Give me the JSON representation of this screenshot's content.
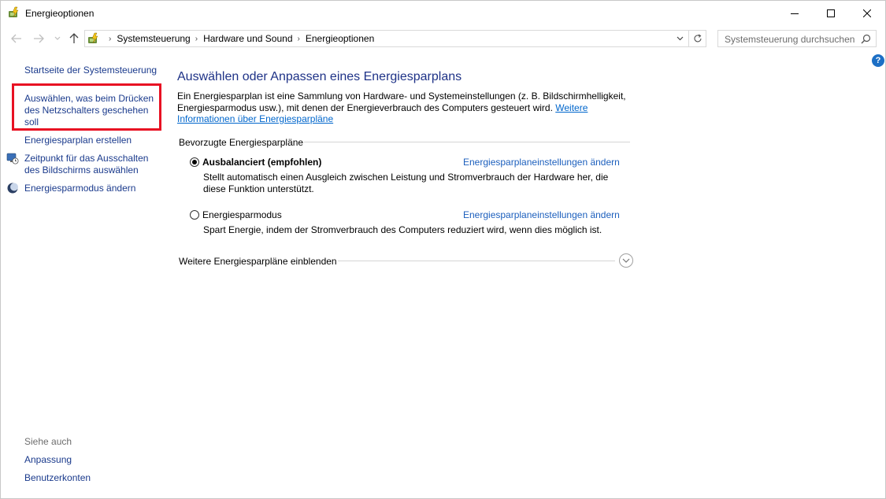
{
  "window": {
    "title": "Energieoptionen",
    "icon": "power-options-icon",
    "controls": [
      "minimize-icon",
      "maximize-icon",
      "close-icon"
    ]
  },
  "nav": {
    "back_icon": "back-arrow-icon",
    "forward_icon": "forward-arrow-icon",
    "recent_icon": "chevron-down-icon",
    "up_icon": "up-arrow-icon"
  },
  "address": {
    "breadcrumbs": [
      "Systemsteuerung",
      "Hardware und Sound",
      "Energieoptionen"
    ],
    "separator": "›"
  },
  "search": {
    "placeholder": "Systemsteuerung durchsuchen"
  },
  "help": {
    "label": "?"
  },
  "sidebar": {
    "home": "Startseite der Systemsteuerung",
    "items": [
      "Auswählen, was beim Drücken des Netzschalters geschehen soll",
      "Energiesparplan erstellen",
      "Zeitpunkt für das Ausschalten des Bildschirms auswählen",
      "Energiesparmodus ändern"
    ],
    "see_also": "Siehe auch",
    "see_also_items": [
      "Anpassung",
      "Benutzerkonten"
    ]
  },
  "main": {
    "title": "Auswählen oder Anpassen eines Energiesparplans",
    "intro": "Ein Energiesparplan ist eine Sammlung von Hardware- und Systemeinstellungen (z. B. Bildschirmhelligkeit, Energiesparmodus usw.), mit denen der Energieverbrauch des Computers gesteuert wird.",
    "intro_link": "Weitere Informationen über Energiesparpläne",
    "section": "Bevorzugte Energiesparpläne",
    "plans": [
      {
        "name": "Ausbalanciert (empfohlen)",
        "selected": true,
        "link": "Energiesparplaneinstellungen ändern",
        "desc_line1": "Stellt automatisch einen Ausgleich zwischen Leistung und Stromverbrauch der Hardware her, die",
        "desc_line2": "diese Funktion unterstützt."
      },
      {
        "name": "Energiesparmodus",
        "selected": false,
        "link": "Energiesparplaneinstellungen ändern",
        "desc_line1": "Spart Energie, indem der Stromverbrauch des Computers reduziert wird, wenn dies möglich ist."
      }
    ],
    "more_plans": "Weitere Energiesparpläne einblenden"
  },
  "colors": {
    "link": "#1a3a8c",
    "title": "#1e3287",
    "highlight": "#e81123",
    "help": "#1c6fc5"
  }
}
